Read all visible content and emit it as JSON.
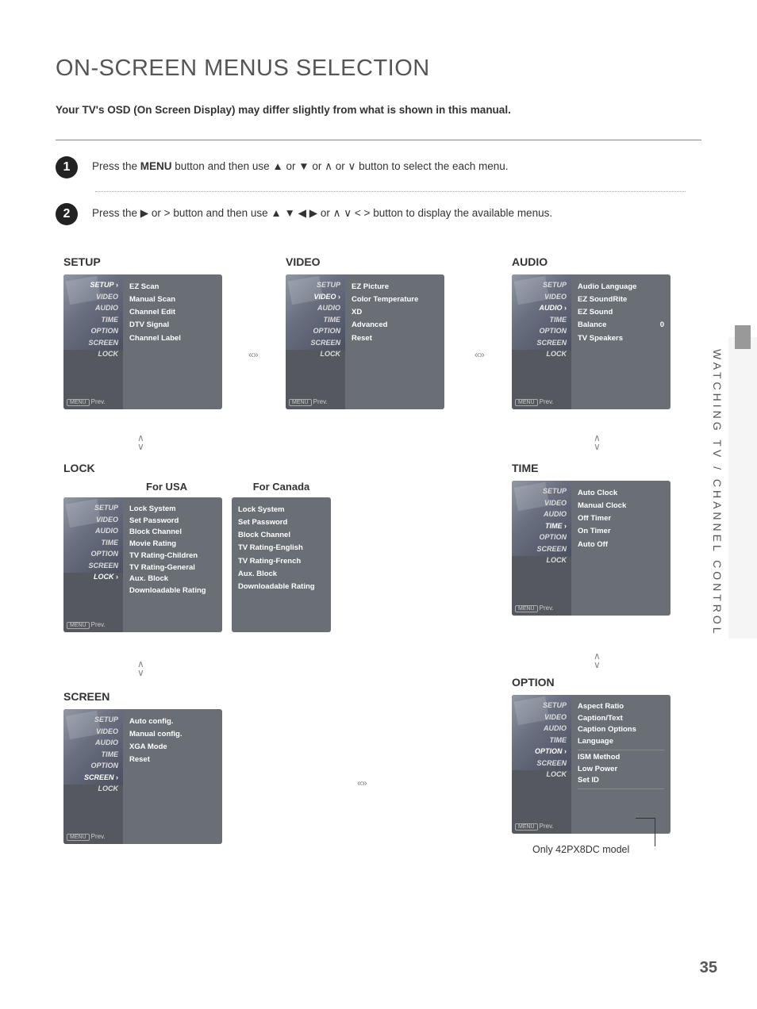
{
  "page": {
    "title": "ON-SCREEN MENUS SELECTION",
    "intro": "Your TV's OSD (On Screen Display) may differ slightly from what is shown in this manual.",
    "side_text": "WATCHING TV / CHANNEL CONTROL",
    "page_number": "35",
    "footnote": "Only 42PX8DC model"
  },
  "steps": [
    {
      "num": "1",
      "pre": "Press the ",
      "bold": "MENU",
      "post": " button and then use  ▲ or ▼  or  ∧  or  ∨  button to select the each menu."
    },
    {
      "num": "2",
      "pre": "Press the ▶  or  >  ",
      "bold": "",
      "post": "button and then use ▲ ▼ ◀ ▶ or  ∧ ∨  <  > button to display the available menus."
    }
  ],
  "nav_items": [
    "SETUP",
    "VIDEO",
    "AUDIO",
    "TIME",
    "OPTION",
    "SCREEN",
    "LOCK"
  ],
  "prev_label": "Prev.",
  "menus": {
    "setup": {
      "title": "SETUP",
      "items": [
        "EZ Scan",
        "Manual Scan",
        "Channel Edit",
        "DTV Signal",
        "Channel Label"
      ]
    },
    "video": {
      "title": "VIDEO",
      "items": [
        "EZ Picture",
        "Color Temperature",
        "XD",
        "Advanced",
        "Reset"
      ]
    },
    "audio": {
      "title": "AUDIO",
      "items": [
        "Audio Language",
        "EZ SoundRite",
        "EZ Sound",
        "Balance",
        "TV Speakers"
      ],
      "balance_value": "0"
    },
    "time": {
      "title": "TIME",
      "items": [
        "Auto Clock",
        "Manual Clock",
        "Off Timer",
        "On Timer",
        "Auto Off"
      ]
    },
    "option": {
      "title": "OPTION",
      "items": [
        "Aspect Ratio",
        "Caption/Text",
        "Caption Options",
        "Language",
        "ISM Method",
        "Low Power",
        "Set ID"
      ]
    },
    "screen": {
      "title": "SCREEN",
      "items": [
        "Auto config.",
        "Manual config.",
        "XGA Mode",
        "Reset"
      ]
    },
    "lock": {
      "title": "LOCK",
      "usa_label": "For USA",
      "canada_label": "For Canada",
      "usa_items": [
        "Lock System",
        "Set Password",
        "Block Channel",
        "Movie Rating",
        "TV Rating-Children",
        "TV Rating-General",
        "Aux. Block",
        "Downloadable Rating"
      ],
      "canada_items": [
        "Lock System",
        "Set Password",
        "Block Channel",
        "TV Rating-English",
        "TV Rating-French",
        "Aux. Block",
        "Downloadable Rating"
      ]
    }
  }
}
